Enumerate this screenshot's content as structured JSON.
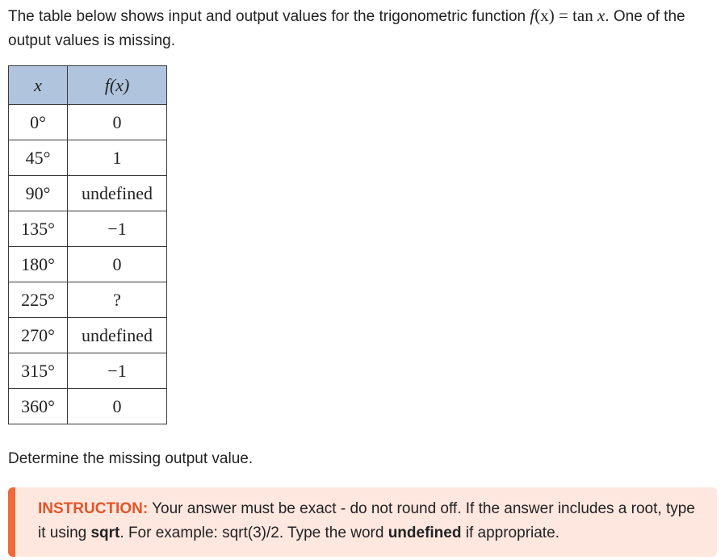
{
  "intro": {
    "before": "The table below shows input and output values for the trigonometric function ",
    "func_lhs": "f",
    "func_arg": "(x)",
    "equals": " = ",
    "func_rhs_name": "tan ",
    "func_rhs_var": "x",
    "after": ". One of the output values is missing."
  },
  "table": {
    "header_x": "x",
    "header_f": "f(x)",
    "rows": [
      {
        "x": "0°",
        "f": "0"
      },
      {
        "x": "45°",
        "f": "1"
      },
      {
        "x": "90°",
        "f": "undefined"
      },
      {
        "x": "135°",
        "f": "−1"
      },
      {
        "x": "180°",
        "f": "0"
      },
      {
        "x": "225°",
        "f": "?"
      },
      {
        "x": "270°",
        "f": "undefined"
      },
      {
        "x": "315°",
        "f": "−1"
      },
      {
        "x": "360°",
        "f": "0"
      }
    ]
  },
  "prompt": "Determine the missing output value.",
  "instruction": {
    "label": "INSTRUCTION:",
    "part1": " Your answer must be exact - do not round off. If the answer includes a root, type it using ",
    "bold1": "sqrt",
    "part2": ". For example: sqrt(3)/2. Type the word ",
    "bold2": "undefined",
    "part3": " if appropriate."
  },
  "colors": {
    "header_bg": "#b0c4de",
    "instruction_bg": "#fde7df",
    "instruction_accent": "#ee6a3b",
    "instruction_label": "#e2562a"
  }
}
